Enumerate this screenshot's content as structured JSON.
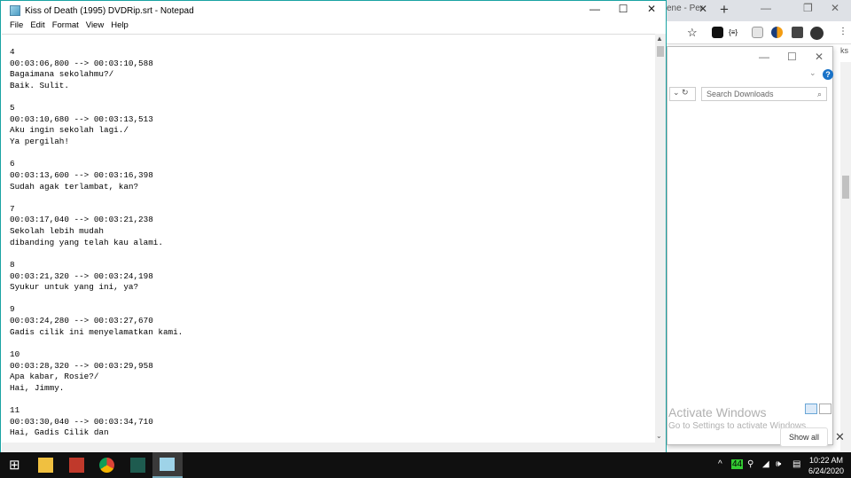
{
  "notepad": {
    "title": "Kiss of Death (1995) DVDRip.srt - Notepad",
    "menu": [
      "File",
      "Edit",
      "Format",
      "View",
      "Help"
    ],
    "content": "4\n00:03:06,800 --> 00:03:10,588\nBagaimana sekolahmu?/\nBaik. Sulit.\n\n5\n00:03:10,680 --> 00:03:13,513\nAku ingin sekolah lagi./\nYa pergilah!\n\n6\n00:03:13,600 --> 00:03:16,398\nSudah agak terlambat, kan?\n\n7\n00:03:17,040 --> 00:03:21,238\nSekolah lebih mudah\ndibanding yang telah kau alami.\n\n8\n00:03:21,320 --> 00:03:24,198\nSyukur untuk yang ini, ya?\n\n9\n00:03:24,280 --> 00:03:27,670\nGadis cilik ini menyelamatkan kami.\n\n10\n00:03:28,320 --> 00:03:29,958\nApa kabar, Rosie?/\nHai, Jimmy.\n\n11\n00:03:30,040 --> 00:03:34,710\nHai, Gadis Cilik dan"
  },
  "chrome": {
    "tab_label": "ene - Per",
    "extensions_label": "{≡}",
    "bookmarks_partial": "ks"
  },
  "downloads": {
    "search_placeholder": "Search Downloads",
    "show_all": "Show all"
  },
  "watermark": {
    "line1": "Activate Windows",
    "line2": "Go to Settings to activate Windows."
  },
  "taskbar": {
    "battery": "44",
    "time": "10:22 AM",
    "date": "6/24/2020"
  },
  "colors": {
    "accent": "#1aa3a3",
    "taskbar": "#101010"
  }
}
